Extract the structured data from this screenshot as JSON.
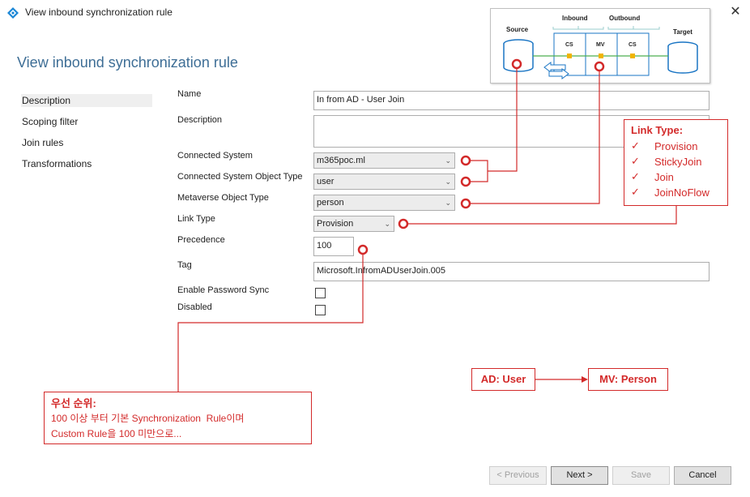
{
  "window": {
    "title": "View inbound synchronization rule"
  },
  "page": {
    "heading": "View inbound synchronization rule"
  },
  "nav": {
    "items": [
      "Description",
      "Scoping filter",
      "Join rules",
      "Transformations"
    ],
    "selected": "Description"
  },
  "form": {
    "name_label": "Name",
    "name_value": "In from AD - User Join",
    "description_label": "Description",
    "description_value": "",
    "connected_system_label": "Connected System",
    "connected_system_value": "m365poc.ml",
    "cs_object_type_label": "Connected System Object Type",
    "cs_object_type_value": "user",
    "mv_object_type_label": "Metaverse Object Type",
    "mv_object_type_value": "person",
    "link_type_label": "Link Type",
    "link_type_value": "Provision",
    "precedence_label": "Precedence",
    "precedence_value": "100",
    "tag_label": "Tag",
    "tag_value": "Microsoft.InfromADUserJoin.005",
    "enable_password_sync_label": "Enable Password Sync",
    "enable_password_sync_checked": false,
    "disabled_label": "Disabled",
    "disabled_checked": false
  },
  "diagram": {
    "source": "Source",
    "target": "Target",
    "inbound": "Inbound",
    "outbound": "Outbound",
    "cs_left": "CS",
    "mv": "MV",
    "cs_right": "CS"
  },
  "annotations": {
    "link_type_box": {
      "title": "Link Type:",
      "items": [
        "Provision",
        "StickyJoin",
        "Join",
        "JoinNoFlow"
      ]
    },
    "ad_user": "AD: User",
    "mv_person": "MV: Person",
    "priority_box": {
      "title": "우선 순위:",
      "line1": "100 이상 부터 기본 Synchronization  Rule이며",
      "line2": "Custom Rule을 100 미만으로..."
    }
  },
  "buttons": {
    "previous": "< Previous",
    "next": "Next >",
    "save": "Save",
    "cancel": "Cancel"
  },
  "colors": {
    "accent": "#3e6e96",
    "annotation_red": "#d32a2a",
    "diagram_blue": "#1a75c4",
    "diagram_gold": "#f0b400"
  }
}
